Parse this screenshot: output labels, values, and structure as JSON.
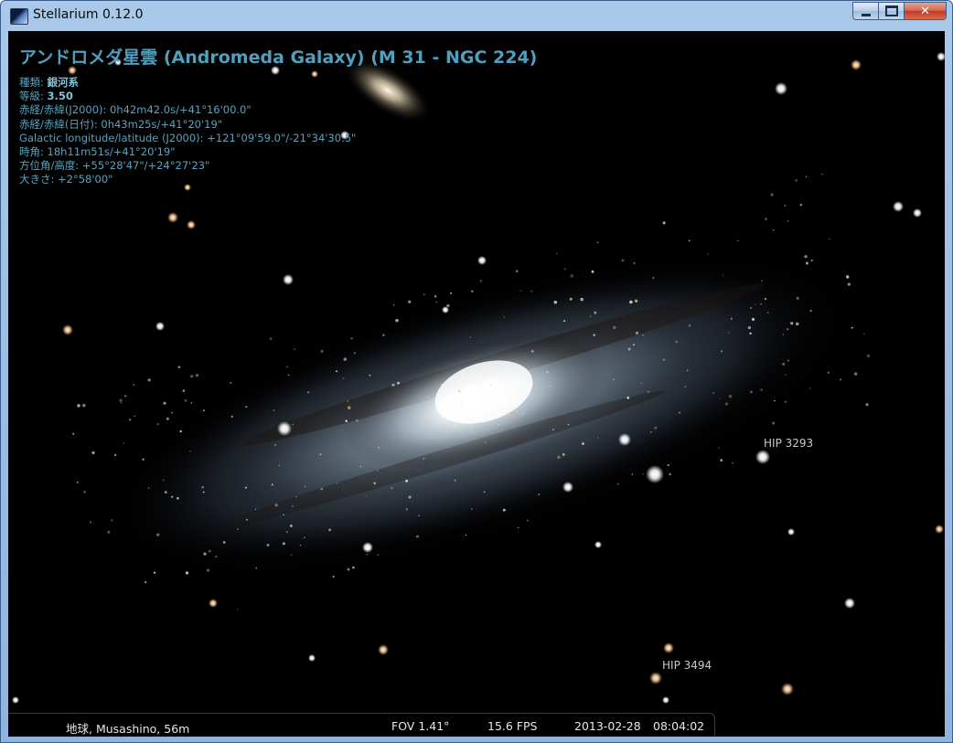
{
  "window": {
    "title": "Stellarium 0.12.0",
    "controls": {
      "minimize": "minimize",
      "maximize": "maximize",
      "close": "✕"
    }
  },
  "object_info": {
    "name": "アンドロメダ星雲 (Andromeda Galaxy) (M 31 - NGC 224)",
    "type_label": "種類: ",
    "type_value": "銀河系",
    "magnitude_label": "等級: ",
    "magnitude_value": "3.50",
    "ra_dec_j2000": "赤経/赤緯(J2000): 0h42m42.0s/+41°16'00.0\"",
    "ra_dec_date": "赤経/赤緯(日付): 0h43m25s/+41°20'19\"",
    "galactic": "Galactic longitude/latitude (J2000): +121°09'59.0\"/-21°34'30.5\"",
    "hour_angle": "時角: 18h11m51s/+41°20'19\"",
    "azimuth_altitude": "方位角/高度: +55°28'47\"/+24°27'23\"",
    "size": "大きさ: +2°58'00\""
  },
  "star_labels": {
    "hip3293": "HIP 3293",
    "hip3494": "HIP 3494"
  },
  "status": {
    "location": "地球, Musashino, 56m",
    "fov": "FOV 1.41°",
    "fps": "15.6 FPS",
    "date": "2013-02-28",
    "time": "08:04:02"
  },
  "colors": {
    "info_text": "#5fa9c2",
    "sky_background": "#000000",
    "title_bar": "#a9c8ea",
    "close_button": "#c8482d"
  }
}
